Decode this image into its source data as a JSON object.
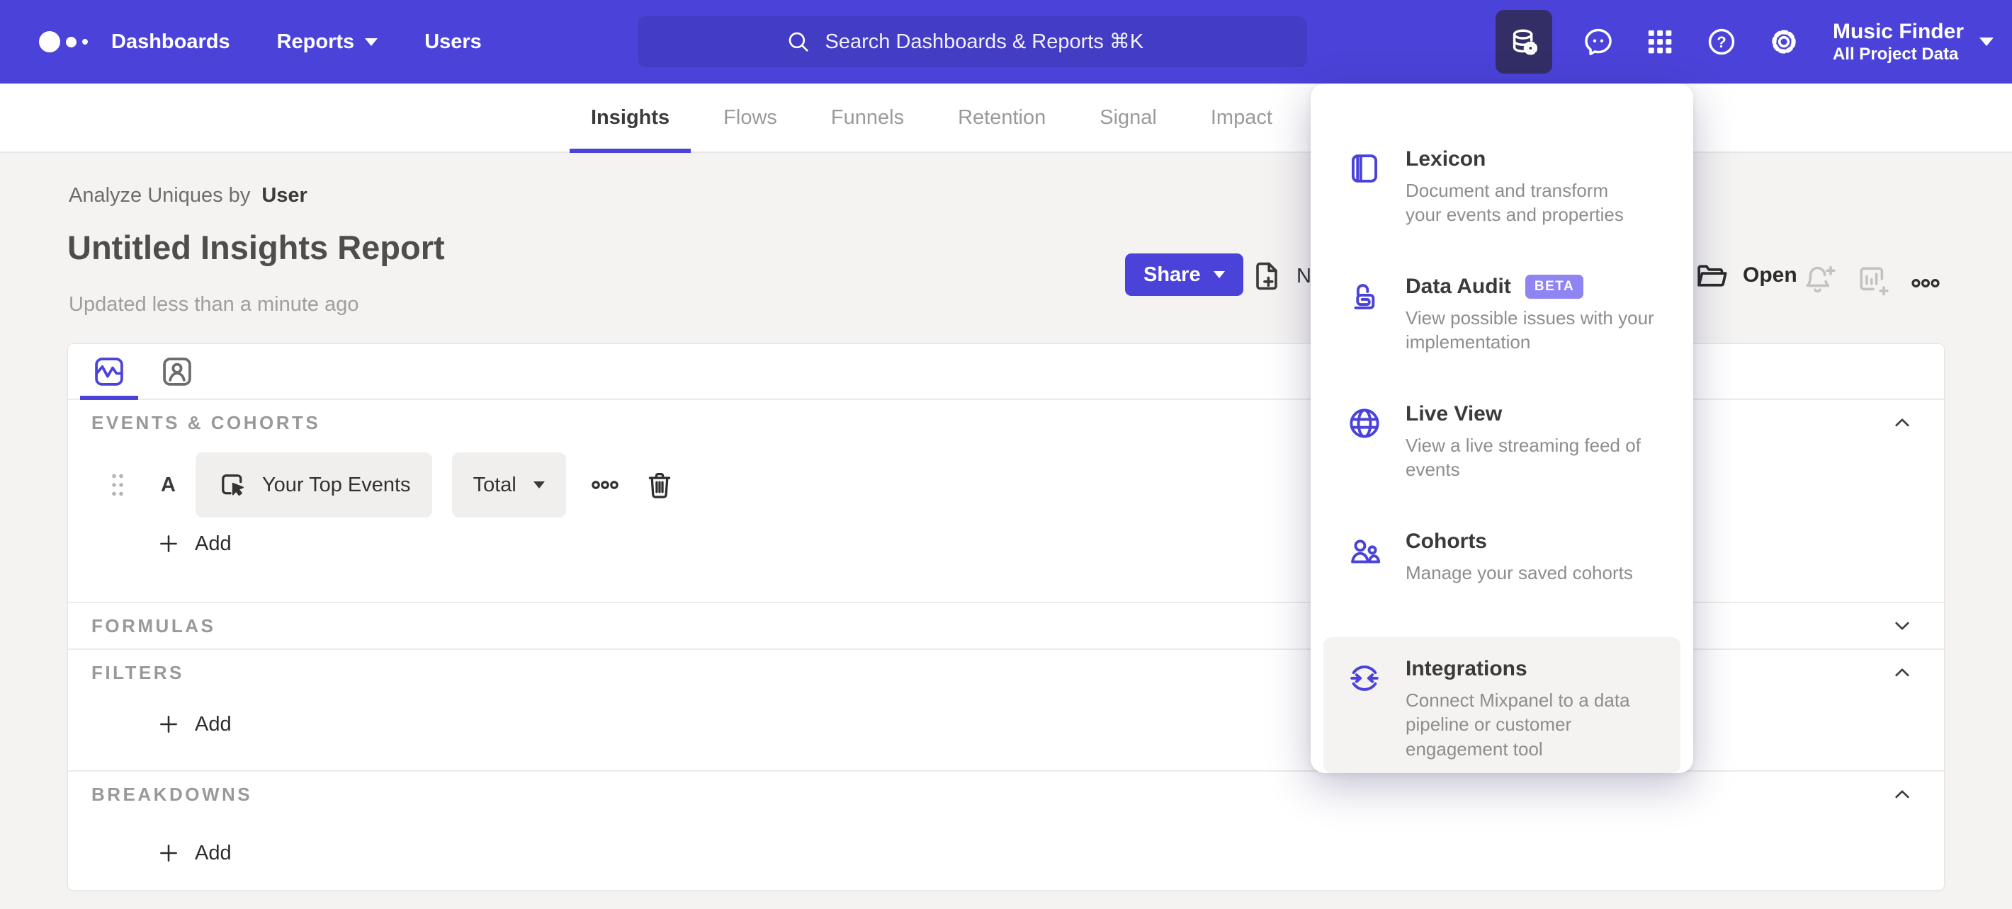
{
  "colors": {
    "brand": "#4B43D9",
    "brand_dark_tile": "#332E66",
    "badge": "#8F84F2",
    "page_bg": "#f4f3f1"
  },
  "topbar": {
    "nav": [
      {
        "label": "Dashboards"
      },
      {
        "label": "Reports"
      },
      {
        "label": "Users"
      }
    ],
    "search": {
      "placeholder": "Search Dashboards & Reports ⌘K"
    },
    "project": {
      "name": "Music Finder",
      "scope": "All Project Data"
    }
  },
  "report_tabs": {
    "items": [
      {
        "label": "Insights",
        "active": true
      },
      {
        "label": "Flows",
        "active": false
      },
      {
        "label": "Funnels",
        "active": false
      },
      {
        "label": "Retention",
        "active": false
      },
      {
        "label": "Signal",
        "active": false
      },
      {
        "label": "Impact",
        "active": false
      }
    ]
  },
  "header": {
    "breadcrumb": {
      "prefix": "Analyze Uniques by",
      "value": "User"
    },
    "title": "Untitled Insights Report",
    "updated": "Updated less than a minute ago",
    "actions": {
      "share": "Share",
      "new": "New",
      "open": "Open"
    }
  },
  "builder": {
    "sections": [
      {
        "label": "EVENTS & COHORTS"
      },
      {
        "label": "FORMULAS"
      },
      {
        "label": "FILTERS"
      },
      {
        "label": "BREAKDOWNS"
      }
    ],
    "event_row": {
      "letter": "A",
      "event_label": "Your Top Events",
      "metric_label": "Total"
    },
    "add_label": "Add"
  },
  "menu": {
    "items": [
      {
        "title": "Lexicon",
        "desc": "Document and transform\nyour events and properties"
      },
      {
        "title": "Data Audit",
        "badge": "BETA",
        "desc": "View possible issues with your\nimplementation"
      },
      {
        "title": "Live View",
        "desc": "View a live streaming feed of\nevents"
      },
      {
        "title": "Cohorts",
        "desc": "Manage your saved cohorts"
      },
      {
        "title": "Integrations",
        "desc": "Connect Mixpanel to a data\npipeline or customer\nengagement tool"
      }
    ]
  }
}
